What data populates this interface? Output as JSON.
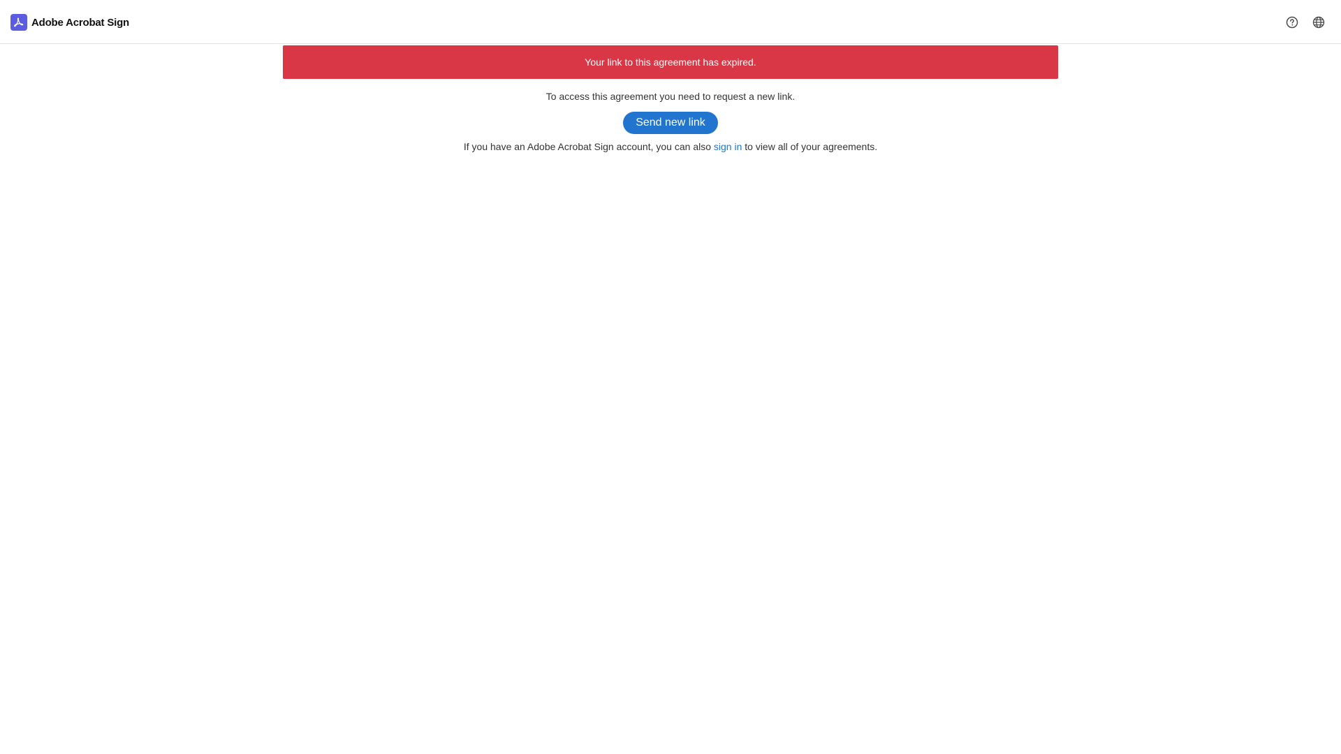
{
  "header": {
    "brand_name": "Adobe Acrobat Sign",
    "logo_icon": "acrobat-logo-icon",
    "help_icon": "help-circle-icon",
    "language_icon": "globe-icon",
    "logo_color": "#5c5ce0"
  },
  "alert": {
    "message": "Your link to this agreement has expired.",
    "color": "#d93745"
  },
  "main": {
    "instruction": "To access this agreement you need to request a new link.",
    "send_button_label": "Send new link",
    "signin_prefix": "If you have an Adobe Acrobat Sign account, you can also ",
    "signin_link": "sign in",
    "signin_suffix": " to view all of your agreements.",
    "accent_color": "#2175cf"
  }
}
